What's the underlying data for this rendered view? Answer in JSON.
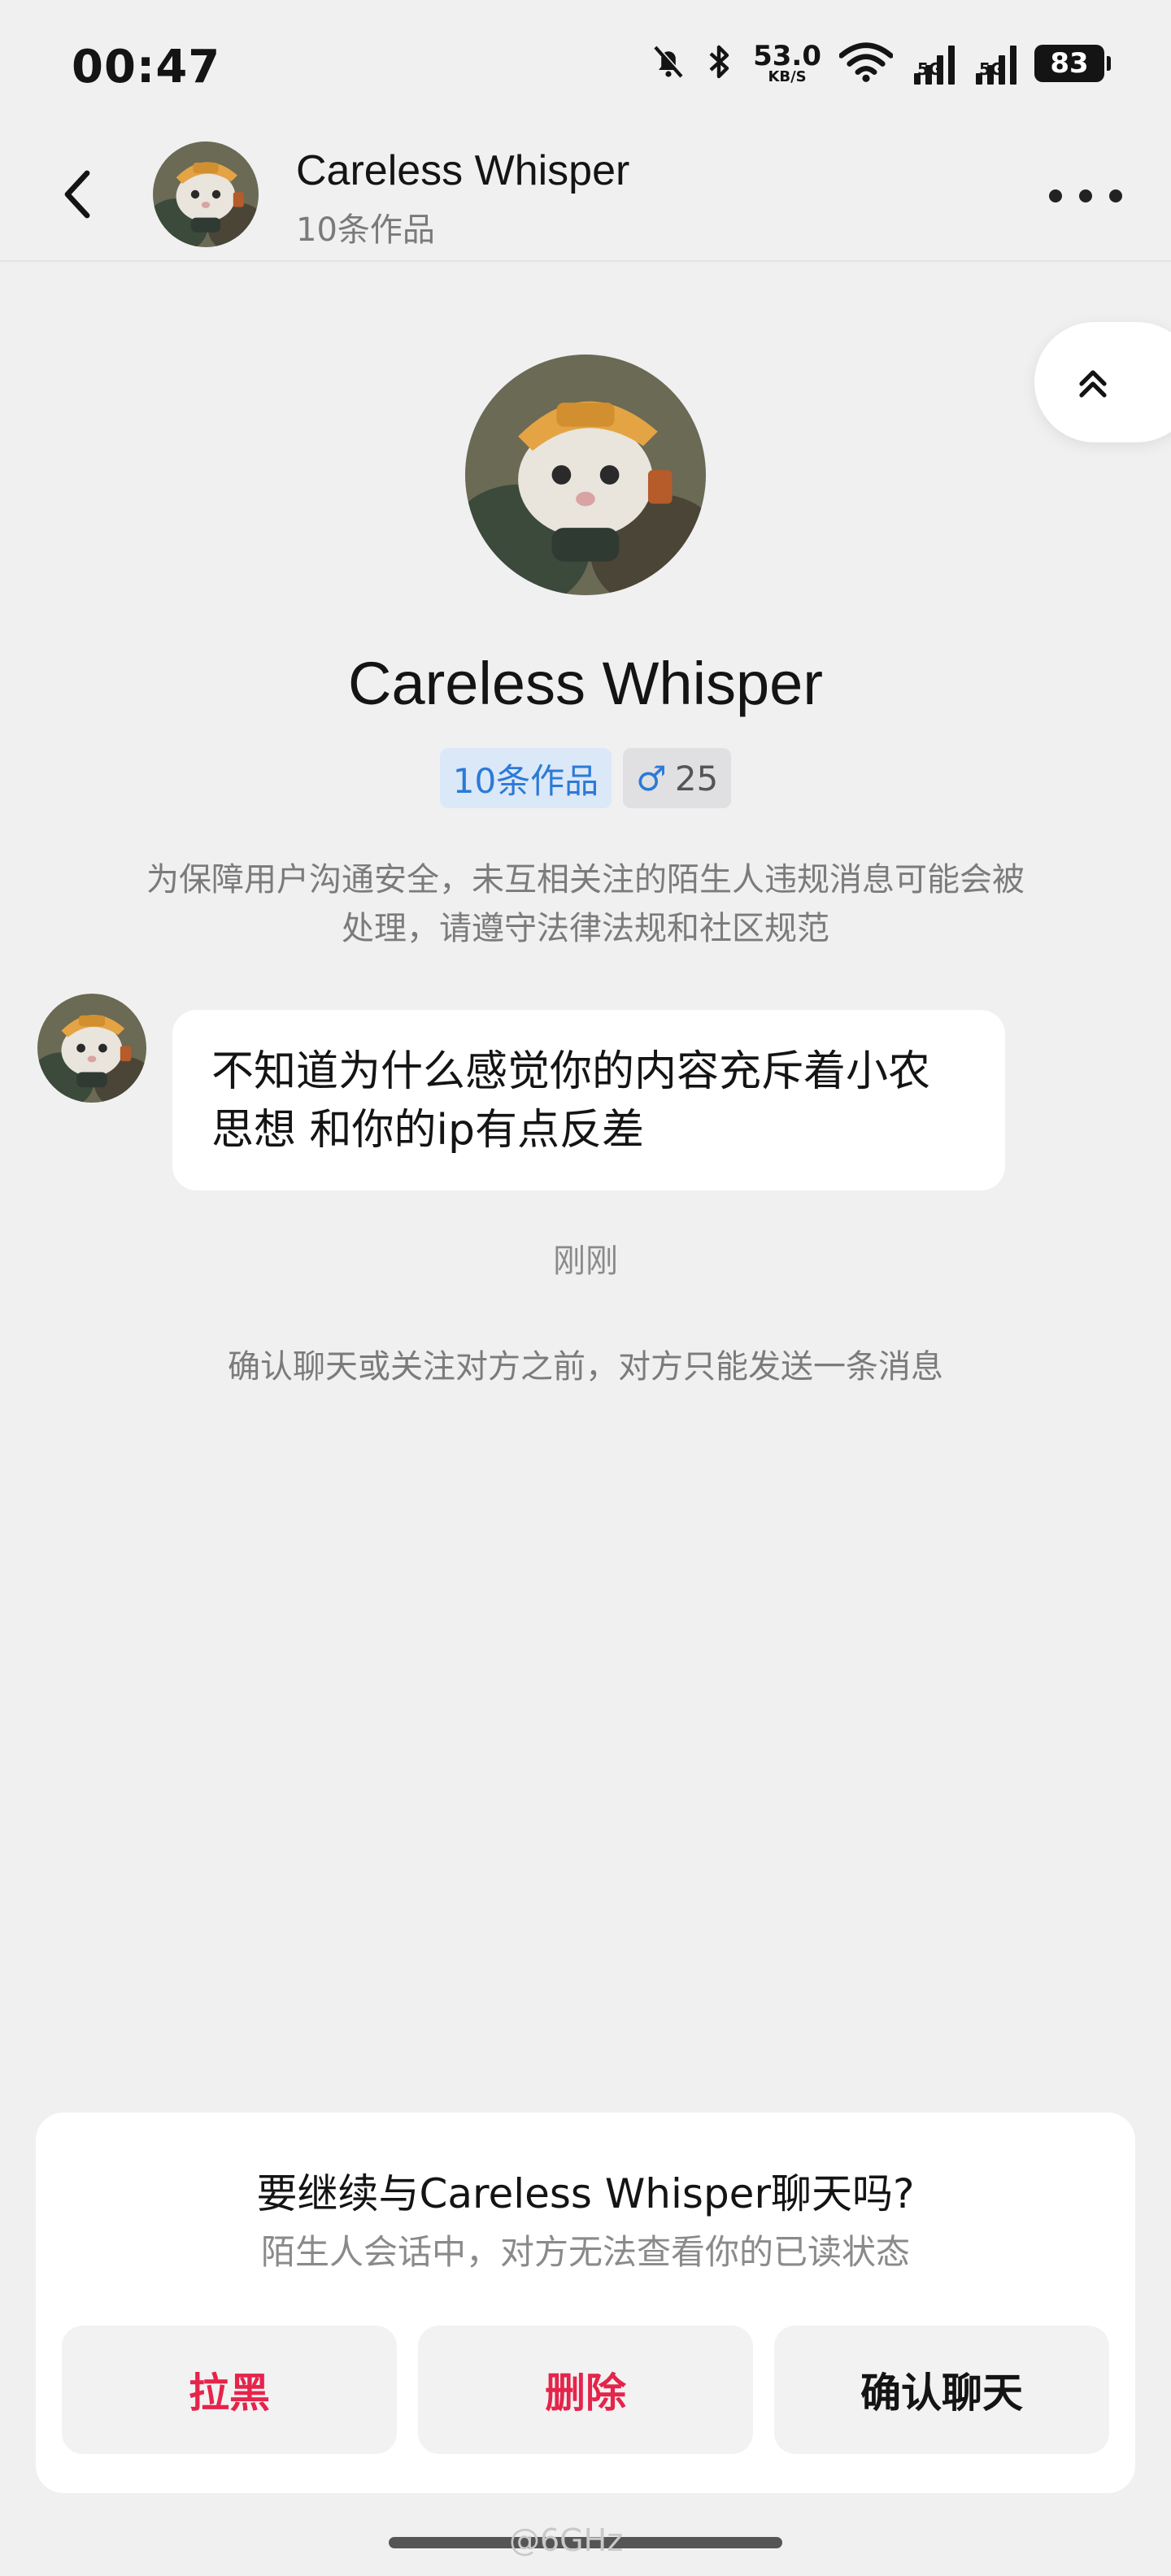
{
  "status_bar": {
    "time": "00:47",
    "net_speed_value": "53.0",
    "net_speed_unit": "KB/S",
    "signal1_tag": "5G",
    "signal2_tag": "5G",
    "battery": "83",
    "icons": [
      "bell-off-icon",
      "bluetooth-icon",
      "wifi-icon",
      "signal-icon",
      "signal-icon"
    ]
  },
  "header": {
    "name": "Careless Whisper",
    "subtitle": "10条作品",
    "back_icon": "chevron-left-icon",
    "more_icon": "more-horizontal-icon"
  },
  "scroll_top_icon": "double-chevron-up-icon",
  "profile": {
    "name": "Careless Whisper",
    "works_tag": "10条作品",
    "gender_symbol": "♂",
    "age": "25",
    "notice": "为保障用户沟通安全，未互相关注的陌生人违规消息可能会被处理，请遵守法律法规和社区规范"
  },
  "messages": [
    {
      "text": "不知道为什么感觉你的内容充斥着小农思想 和你的ip有点反差",
      "from": "other"
    }
  ],
  "timestamp": "刚刚",
  "hint": "确认聊天或关注对方之前，对方只能发送一条消息",
  "prompt_card": {
    "title": "要继续与Careless Whisper聊天吗?",
    "subtitle": "陌生人会话中，对方无法查看你的已读状态",
    "buttons": {
      "block": "拉黑",
      "delete": "删除",
      "confirm": "确认聊天"
    }
  },
  "watermark": "@6GHz",
  "colors": {
    "background": "#f0f0f1",
    "accent_blue": "#2c7ad6",
    "danger_red": "#e5244a"
  }
}
